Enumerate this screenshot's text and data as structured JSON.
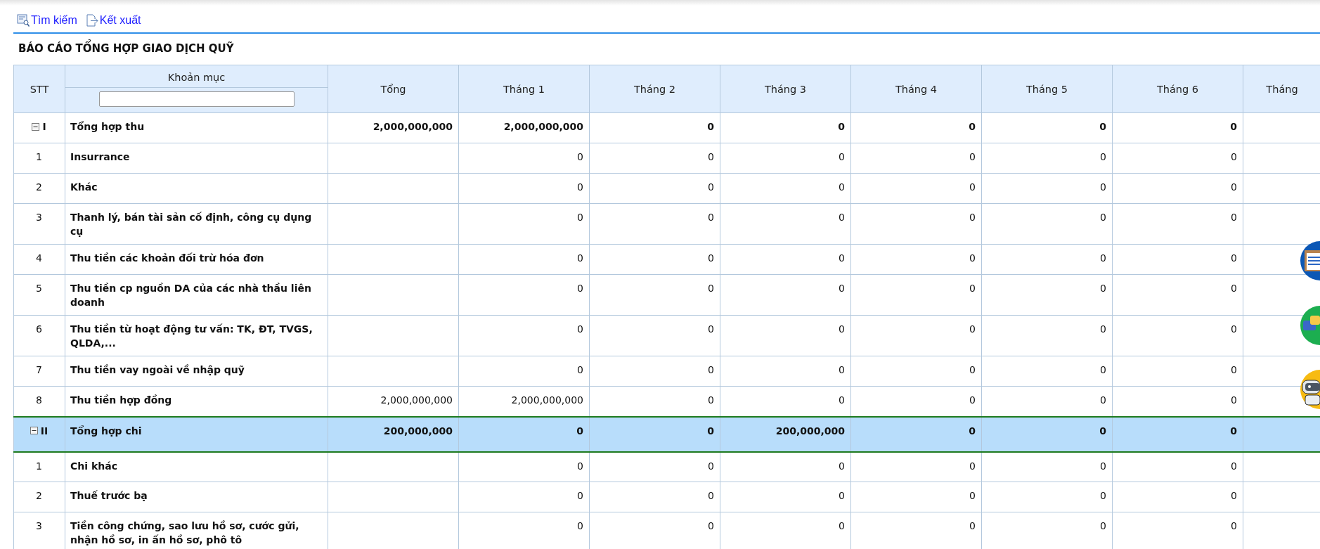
{
  "toolbar": [
    {
      "kind": "search",
      "label": "Tìm kiếm"
    },
    {
      "kind": "export",
      "label": "Kết xuất"
    }
  ],
  "title": "BÁO CÁO TỔNG HỢP GIAO DỊCH QUỸ",
  "table": {
    "columns": [
      "STT",
      "Khoản mục",
      "Tổng",
      "Tháng 1",
      "Tháng 2",
      "Tháng 3",
      "Tháng 4",
      "Tháng 5",
      "Tháng 6",
      "Tháng"
    ],
    "rows": [
      {
        "kind": "group",
        "stt": "I",
        "label": "Tổng hợp thu",
        "expanded": true,
        "selected": false,
        "total": "2,000,000,000",
        "months": [
          "2,000,000,000",
          "0",
          "0",
          "0",
          "0",
          "0"
        ]
      },
      {
        "kind": "item",
        "stt": "1",
        "label": "Insurrance",
        "selected": false,
        "months": [
          "0",
          "0",
          "0",
          "0",
          "0",
          "0"
        ]
      },
      {
        "kind": "item",
        "stt": "2",
        "label": "Khác",
        "selected": false,
        "months": [
          "0",
          "0",
          "0",
          "0",
          "0",
          "0"
        ]
      },
      {
        "kind": "item",
        "stt": "3",
        "label": "Thanh lý, bán tài sản cố định, công cụ dụng cụ",
        "selected": false,
        "months": [
          "0",
          "0",
          "0",
          "0",
          "0",
          "0"
        ]
      },
      {
        "kind": "item",
        "stt": "4",
        "label": "Thu tiền các khoản đối trừ hóa đơn",
        "selected": false,
        "months": [
          "0",
          "0",
          "0",
          "0",
          "0",
          "0"
        ]
      },
      {
        "kind": "item",
        "stt": "5",
        "label": "Thu tiền cp nguồn DA của các nhà thầu liên doanh",
        "selected": false,
        "months": [
          "0",
          "0",
          "0",
          "0",
          "0",
          "0"
        ]
      },
      {
        "kind": "item",
        "stt": "6",
        "label": "Thu tiền từ hoạt động tư vấn: TK, ĐT, TVGS, QLDA,...",
        "selected": false,
        "months": [
          "0",
          "0",
          "0",
          "0",
          "0",
          "0"
        ]
      },
      {
        "kind": "item",
        "stt": "7",
        "label": "Thu tiền vay ngoài về nhập quỹ",
        "selected": false,
        "months": [
          "0",
          "0",
          "0",
          "0",
          "0",
          "0"
        ]
      },
      {
        "kind": "item",
        "stt": "8",
        "label": "Thu tiền hợp đồng",
        "selected": false,
        "total": "2,000,000,000",
        "months": [
          "2,000,000,000",
          "0",
          "0",
          "0",
          "0",
          "0"
        ]
      },
      {
        "kind": "group",
        "stt": "II",
        "label": "Tổng hợp chi",
        "expanded": true,
        "selected": true,
        "total": "200,000,000",
        "months": [
          "0",
          "0",
          "200,000,000",
          "0",
          "0",
          "0"
        ]
      },
      {
        "kind": "item",
        "stt": "1",
        "label": "Chi khác",
        "selected": false,
        "months": [
          "0",
          "0",
          "0",
          "0",
          "0",
          "0"
        ]
      },
      {
        "kind": "item",
        "stt": "2",
        "label": "Thuế trước bạ",
        "selected": false,
        "months": [
          "0",
          "0",
          "0",
          "0",
          "0",
          "0"
        ]
      },
      {
        "kind": "item",
        "stt": "3",
        "label": "Tiền công chứng, sao lưu hồ sơ, cước gửi, nhận hồ sơ, in ấn hồ sơ, phô tô",
        "selected": false,
        "months": [
          "0",
          "0",
          "0",
          "0",
          "0",
          "0"
        ]
      }
    ]
  },
  "floating_buttons": [
    {
      "kind": "clipboard"
    },
    {
      "kind": "chat"
    },
    {
      "kind": "robot"
    }
  ]
}
